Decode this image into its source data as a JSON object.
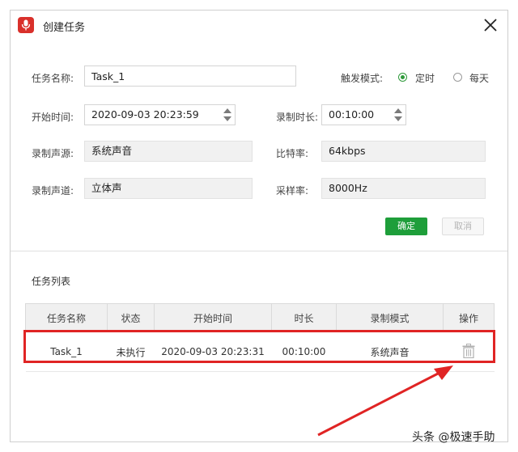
{
  "window": {
    "title": "创建任务"
  },
  "form": {
    "task_name_label": "任务名称:",
    "task_name_value": "Task_1",
    "trigger_label": "触发模式:",
    "trigger_options": [
      {
        "label": "定时",
        "selected": true
      },
      {
        "label": "每天",
        "selected": false
      }
    ],
    "start_time_label": "开始时间:",
    "start_time_value": "2020-09-03  20:23:59",
    "duration_label": "录制时长:",
    "duration_value": "00:10:00",
    "source_label": "录制声源:",
    "source_value": "系统声音",
    "bitrate_label": "比特率:",
    "bitrate_value": "64kbps",
    "channel_label": "录制声道:",
    "channel_value": "立体声",
    "samplerate_label": "采样率:",
    "samplerate_value": "8000Hz",
    "ok_label": "确定",
    "cancel_label": "取消"
  },
  "task_list": {
    "title": "任务列表",
    "headers": [
      "任务名称",
      "状态",
      "开始时间",
      "时长",
      "录制模式",
      "操作"
    ],
    "rows": [
      {
        "name": "Task_1",
        "status": "未执行",
        "start": "2020-09-03  20:23:31",
        "duration": "00:10:00",
        "mode": "系统声音"
      }
    ]
  },
  "watermark": "头条 @极速手助",
  "colors": {
    "accent_green": "#1e9e3a",
    "highlight_red": "#e02424",
    "app_icon_red": "#d9302b"
  },
  "icons": {
    "app": "microphone-icon",
    "close": "close-icon",
    "delete": "trash-icon"
  }
}
